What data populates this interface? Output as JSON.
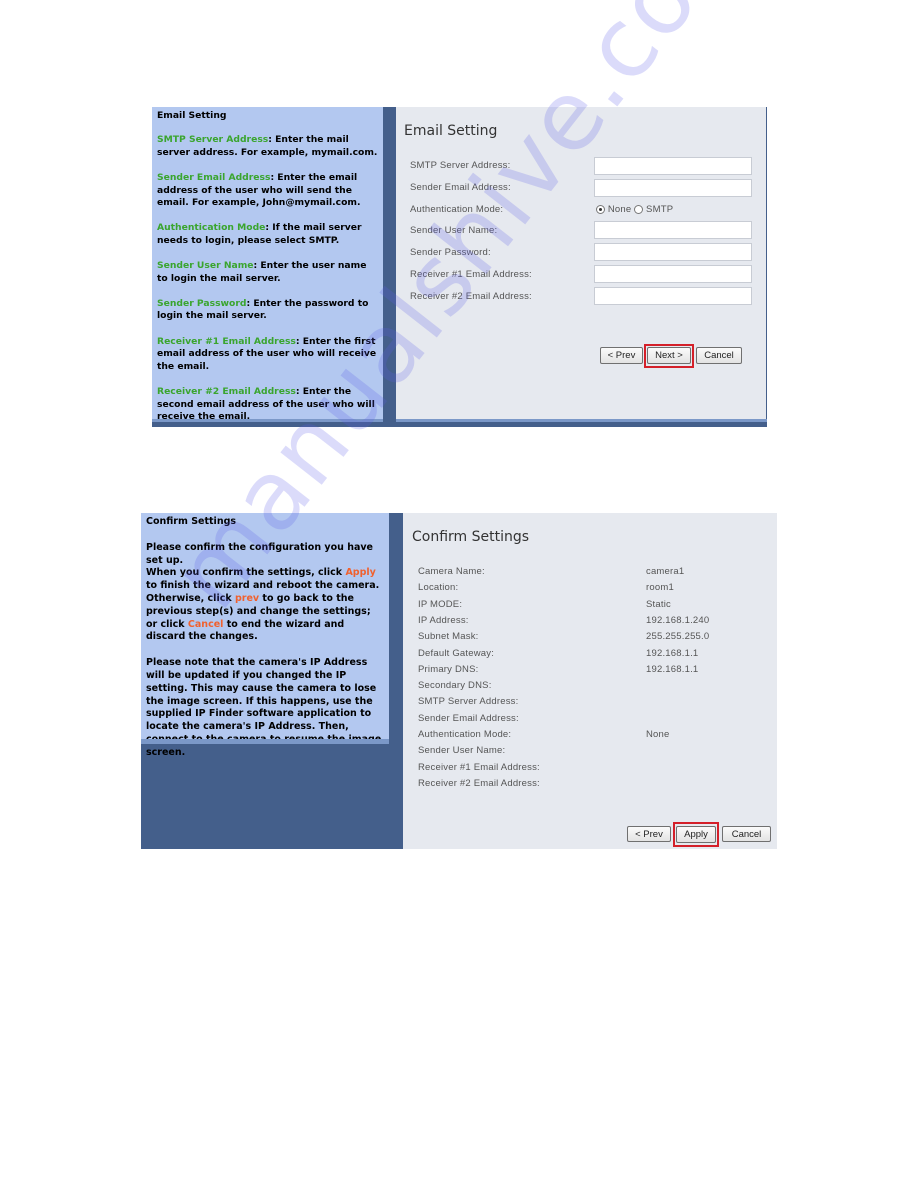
{
  "email_setting": {
    "help": {
      "title": "Email Setting",
      "items": [
        {
          "term": "SMTP Server Address",
          "text": ": Enter the mail server address. For example, mymail.com."
        },
        {
          "term": "Sender Email Address",
          "text": ": Enter the email address of the user who will send the email. For example, John@mymail.com."
        },
        {
          "term": "Authentication Mode",
          "text": ": If the mail server needs to login, please select SMTP."
        },
        {
          "term": "Sender User Name",
          "text": ": Enter the user name to login the mail server."
        },
        {
          "term": "Sender Password",
          "text": ": Enter the password to login the mail server."
        },
        {
          "term": "Receiver #1 Email Address",
          "text": ": Enter the first email address of the user who will receive the email."
        },
        {
          "term": "Receiver #2 Email Address",
          "text": ": Enter the second email address of the user who will receive the email."
        }
      ]
    },
    "title": "Email Setting",
    "fields": [
      {
        "label": "SMTP Server Address:",
        "value": ""
      },
      {
        "label": "Sender Email Address:",
        "value": ""
      },
      {
        "label": "Authentication Mode:",
        "value": ""
      },
      {
        "label": "Sender User Name:",
        "value": ""
      },
      {
        "label": "Sender Password:",
        "value": ""
      },
      {
        "label": "Receiver #1 Email Address:",
        "value": ""
      },
      {
        "label": "Receiver #2 Email Address:",
        "value": ""
      }
    ],
    "auth_options": [
      {
        "label": "None",
        "selected": true
      },
      {
        "label": "SMTP",
        "selected": false
      }
    ],
    "buttons": {
      "prev": "< Prev",
      "next": "Next >",
      "cancel": "Cancel"
    },
    "highlighted_button": "next"
  },
  "confirm_settings": {
    "help": {
      "title": "Confirm Settings",
      "p1": "Please confirm the configuration you have set up.",
      "p2_a": "When you confirm the settings, click ",
      "p2_apply": "Apply",
      "p2_b": " to finish the wizard and reboot the camera. Otherwise, click ",
      "p2_prev": "prev",
      "p2_c": " to go back to the previous step(s) and change the settings; or click ",
      "p2_cancel": "Cancel",
      "p2_d": " to end the wizard and discard the changes.",
      "p3": "Please note that the camera's IP Address will be updated if you changed the IP setting. This may cause the camera to lose the image screen. If this happens, use the supplied IP Finder software application to locate the camera's IP Address. Then, connect to the camera to resume the image screen."
    },
    "title": "Confirm Settings",
    "rows": [
      {
        "label": "Camera Name:",
        "value": "camera1"
      },
      {
        "label": "Location:",
        "value": "room1"
      },
      {
        "label": "IP MODE:",
        "value": "Static"
      },
      {
        "label": "IP Address:",
        "value": "192.168.1.240"
      },
      {
        "label": "Subnet Mask:",
        "value": "255.255.255.0"
      },
      {
        "label": "Default Gateway:",
        "value": "192.168.1.1"
      },
      {
        "label": "Primary DNS:",
        "value": "192.168.1.1"
      },
      {
        "label": "Secondary DNS:",
        "value": ""
      },
      {
        "label": "SMTP Server Address:",
        "value": ""
      },
      {
        "label": "Sender Email Address:",
        "value": ""
      },
      {
        "label": "Authentication Mode:",
        "value": "None"
      },
      {
        "label": "Sender User Name:",
        "value": ""
      },
      {
        "label": "Receiver #1 Email Address:",
        "value": ""
      },
      {
        "label": "Receiver #2 Email Address:",
        "value": ""
      }
    ],
    "buttons": {
      "prev": "< Prev",
      "apply": "Apply",
      "cancel": "Cancel"
    },
    "highlighted_button": "apply"
  },
  "watermark": "manualshive.com",
  "colors": {
    "help_bg": "#b3c8f0",
    "frame_blue": "#445f8b",
    "panel_bg": "#e6e9ef",
    "term_green": "#3aa52e",
    "link_orange": "#f0612f",
    "highlight_red": "#d4202a"
  }
}
